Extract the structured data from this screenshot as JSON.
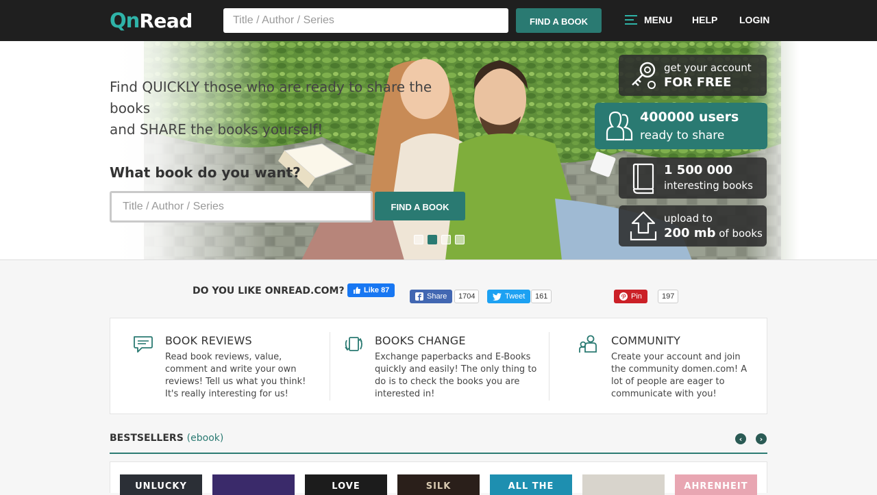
{
  "header": {
    "logo_glyph": "Qn",
    "logo_word": "Read",
    "search_placeholder": "Title / Author / Series",
    "find_button": "FIND A BOOK",
    "menu_label": "MENU",
    "help_label": "HELP",
    "login_label": "LOGIN"
  },
  "hero": {
    "tagline_line1": "Find QUICKLY those who are ready to share the books",
    "tagline_line2": "and SHARE the books yourself!",
    "question": "What book do you want?",
    "search_placeholder": "Title / Author / Series",
    "find_button": "FIND A BOOK",
    "slides": 4,
    "active_slide": 2,
    "stats": [
      {
        "icon": "key-icon",
        "line1": "get your account",
        "line2": "FOR FREE"
      },
      {
        "icon": "users-icon",
        "line1": "400000 users",
        "line2": "ready to share"
      },
      {
        "icon": "book-icon",
        "line1": "1 500 000",
        "line2": "interesting books"
      },
      {
        "icon": "upload-icon",
        "line1": "upload to",
        "line2_bold": "200 mb",
        "line2_rest": " of books"
      }
    ]
  },
  "social": {
    "question": "DO YOU LIKE ONREAD.COM?",
    "fb_like_label": "Like 87",
    "share_label": "Share",
    "share_count": "1704",
    "tweet_label": "Tweet",
    "tweet_count": "161",
    "pin_label": "Pin",
    "pin_count": "197"
  },
  "features": [
    {
      "icon": "chat-icon",
      "title": "BOOK REVIEWS",
      "text": "Read book reviews, value, comment and write your own reviews! Tell us what you think! It's really interesting for us!"
    },
    {
      "icon": "exchange-book-icon",
      "title": "BOOKS CHANGE",
      "text": "Exchange paperbacks and E-Books quickly and easily! The only thing to do is to check the books you are interested in!"
    },
    {
      "icon": "community-icon",
      "title": "COMMUNITY",
      "text": "Create your account and join the community domen.com! A lot of people are eager to communicate with you!"
    }
  ],
  "bestsellers": {
    "title": "BESTSELLERS",
    "subtitle": "(ebook)",
    "books": [
      {
        "cover_text": "UNLUCKY",
        "bg": "#2b2f36",
        "fg": "#ffffff"
      },
      {
        "cover_text": "",
        "bg": "#3a2a6a",
        "fg": "#ffffff"
      },
      {
        "cover_text": "LOVE",
        "bg": "#1c1c1c",
        "fg": "#ffffff"
      },
      {
        "cover_text": "SILK",
        "bg": "#2a1f1a",
        "fg": "#d8c9b0"
      },
      {
        "cover_text": "ALL THE",
        "bg": "#1e8fb0",
        "fg": "#ffffff"
      },
      {
        "cover_text": "",
        "bg": "#d8d4cc",
        "fg": "#555555"
      },
      {
        "cover_text": "AHRENHEIT",
        "bg": "#e8a6b2",
        "fg": "#ffffff"
      }
    ]
  },
  "colors": {
    "accent": "#2a7a72",
    "header_bg": "#1f1f1f",
    "logo_accent": "#2fb3a8"
  }
}
